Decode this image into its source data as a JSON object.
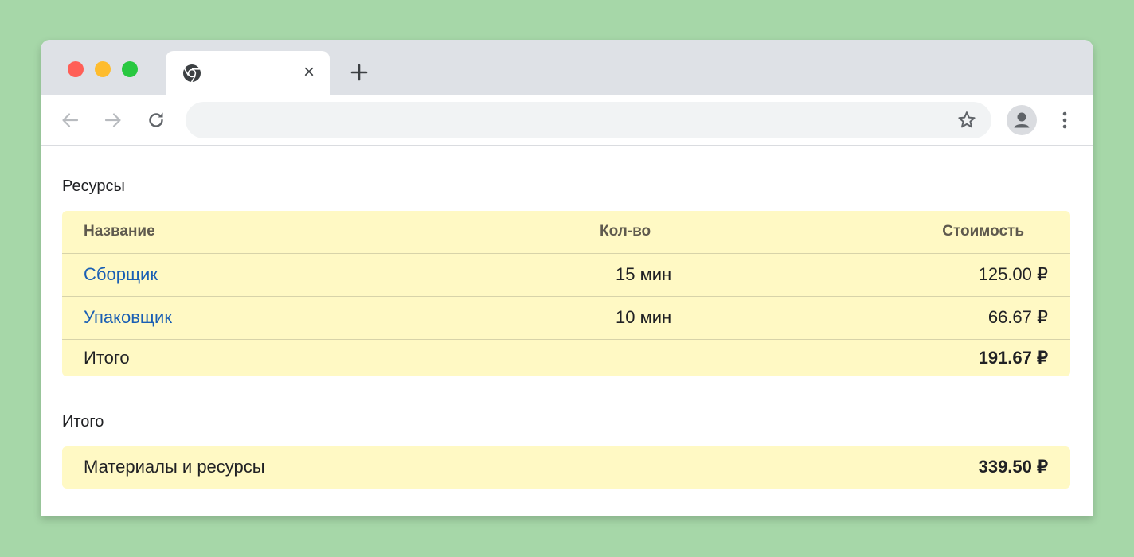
{
  "browser": {
    "tab": {
      "close_label": "×"
    },
    "toolbar": {
      "address": {
        "value": "",
        "placeholder": ""
      }
    },
    "icons": {
      "favicon": "chrome-icon",
      "close": "close-icon",
      "new_tab": "plus-icon",
      "back": "arrow-left-icon",
      "forward": "arrow-right-icon",
      "reload": "reload-icon",
      "bookmark": "star-icon",
      "profile": "user-icon",
      "menu": "kebab-menu-icon"
    },
    "colors": {
      "background": "#a6d7a8",
      "tabstrip": "#dee1e6",
      "omnibox": "#f1f3f4",
      "table_bg": "#fff9c4",
      "link": "#1a5fb4"
    }
  },
  "resources": {
    "title": "Ресурсы",
    "columns": [
      "Название",
      "Кол-во",
      "Стоимость"
    ],
    "rows": [
      {
        "name": "Сборщик",
        "qty": "15 мин",
        "cost": "125.00 ₽"
      },
      {
        "name": "Упаковщик",
        "qty": "10 мин",
        "cost": "66.67 ₽"
      }
    ],
    "total": {
      "label": "Итого",
      "cost": "191.67 ₽"
    }
  },
  "totals": {
    "title": "Итого",
    "label": "Материалы и ресурсы",
    "value": "339.50 ₽"
  }
}
